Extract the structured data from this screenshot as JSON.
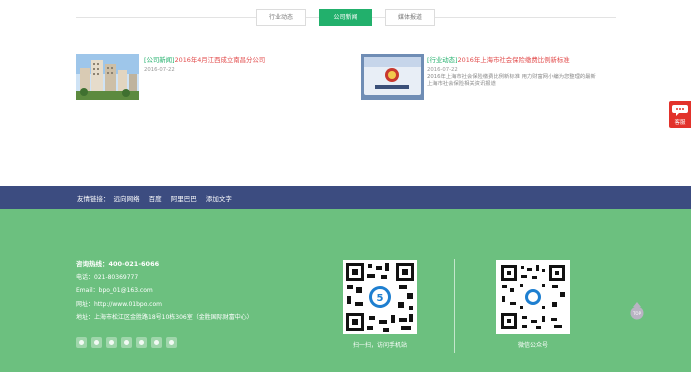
{
  "tabs": [
    {
      "label": "行业动态",
      "active": false
    },
    {
      "label": "公司新闻",
      "active": true
    },
    {
      "label": "媒体报道",
      "active": false
    }
  ],
  "news": [
    {
      "category": "[公司新闻]",
      "title": "2016年4月江西成立南昌分公司",
      "date": "2016-07-22",
      "description": ""
    },
    {
      "category": "[行业动态]",
      "title": "2016年上海市社会保险缴费比例新标准",
      "date": "2016-07-22",
      "description_lines": [
        "2016年上海市社会保险缴费比例新标准 用力财富网小编为您整理的最新",
        "上海市社会保险相关资讯报道"
      ]
    }
  ],
  "float_service": {
    "label": "客服"
  },
  "links": {
    "label": "友情链接：",
    "items": [
      "远向网络",
      "百度",
      "阿里巴巴",
      "添加文字"
    ]
  },
  "contact": {
    "hotline_label": "咨询热线：",
    "hotline": "400-021-6066",
    "phone": "电话：021-80369777",
    "email": "Email：bpo_01@163.com",
    "website": "网址：http://www.01bpo.com",
    "address": "地址：上海市松江区金胜路18号10栋306室（金胜国际财富中心）"
  },
  "social_icons": [
    "plus-icon",
    "qq-icon",
    "renren-icon",
    "weibo-icon",
    "douban-icon",
    "kaixin-icon",
    "more-icon"
  ],
  "qrcodes": [
    {
      "caption": "扫一扫，访问手机站"
    },
    {
      "caption": "微信公众号"
    }
  ],
  "top_button": {
    "label": "TOP"
  },
  "colors": {
    "green": "#6cc07f",
    "tab_active": "#22b06c",
    "navy": "#3c4c80",
    "red": "#e2322b",
    "news_title": "#e24b4b"
  }
}
